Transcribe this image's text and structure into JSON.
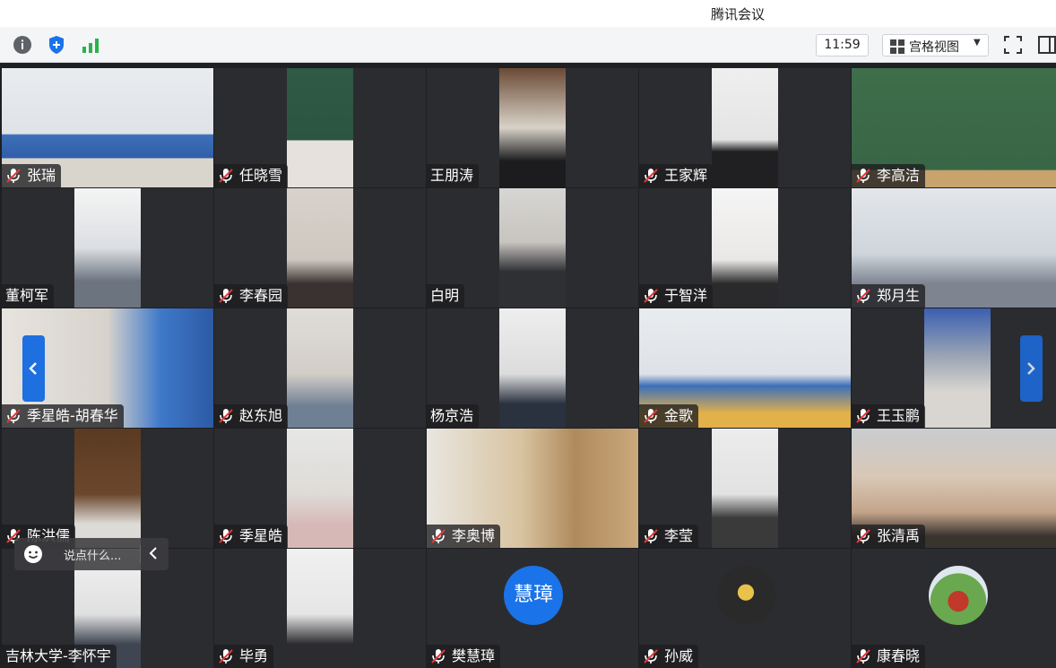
{
  "app": {
    "title": "腾讯会议"
  },
  "toolbar": {
    "time": "11:59",
    "view_label": "宫格视图",
    "icons": [
      "info-icon",
      "shield-icon",
      "signal-icon",
      "fullscreen-icon",
      "sidebar-icon"
    ]
  },
  "chat": {
    "placeholder": "说点什么..."
  },
  "participants": [
    {
      "name": "张瑞",
      "muted": true
    },
    {
      "name": "任晓雪",
      "muted": true
    },
    {
      "name": "王朋涛",
      "muted": false
    },
    {
      "name": "王家辉",
      "muted": true
    },
    {
      "name": "李高洁",
      "muted": true
    },
    {
      "name": "董柯军",
      "muted": false
    },
    {
      "name": "李春园",
      "muted": true
    },
    {
      "name": "白明",
      "muted": false
    },
    {
      "name": "于智洋",
      "muted": true
    },
    {
      "name": "郑月生",
      "muted": true
    },
    {
      "name": "季星皓-胡春华",
      "muted": true
    },
    {
      "name": "赵东旭",
      "muted": true
    },
    {
      "name": "杨京浩",
      "muted": false
    },
    {
      "name": "金歌",
      "muted": true
    },
    {
      "name": "王玉鹏",
      "muted": true
    },
    {
      "name": "陈洪儒",
      "muted": true
    },
    {
      "name": "季星皓",
      "muted": true
    },
    {
      "name": "李奥博",
      "muted": true
    },
    {
      "name": "李莹",
      "muted": true
    },
    {
      "name": "张清禹",
      "muted": true
    },
    {
      "name": "吉林大学-李怀宇",
      "muted": false
    },
    {
      "name": "毕勇",
      "muted": true
    },
    {
      "name": "樊慧璋",
      "muted": true,
      "avatar_text": "慧璋"
    },
    {
      "name": "孙威",
      "muted": true
    },
    {
      "name": "康春晓",
      "muted": true
    }
  ]
}
